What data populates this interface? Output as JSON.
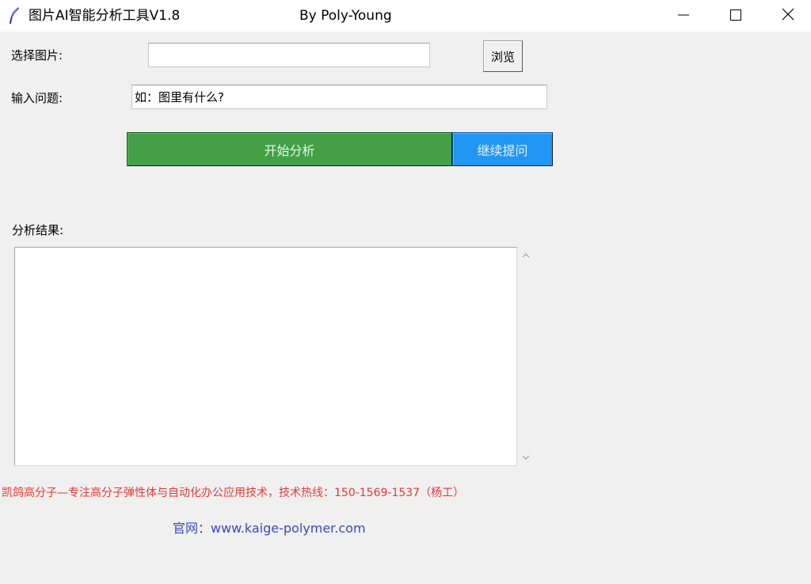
{
  "window": {
    "title": "图片AI智能分析工具V1.8",
    "author": "By Poly-Young",
    "icon": "feather-icon",
    "controls": [
      "minimize-icon",
      "maximize-icon",
      "close-icon"
    ]
  },
  "form": {
    "image_label": "选择图片:",
    "image_value": "",
    "browse_label": "浏览",
    "question_label": "输入问题:",
    "question_value": "如：图里有什么?"
  },
  "actions": {
    "start_label": "开始分析",
    "start_color": "#43a047",
    "continue_label": "继续提问",
    "continue_color": "#2196f3"
  },
  "result": {
    "label": "分析结果:",
    "text": ""
  },
  "footer": {
    "company": "凯鸽高分子—专注高分子弹性体与自动化办公应用技术，技术热线：150-1569-1537（杨工）",
    "company_color": "#e53935",
    "website": "官网：www.kaige-polymer.com",
    "website_color": "#3949c4"
  }
}
